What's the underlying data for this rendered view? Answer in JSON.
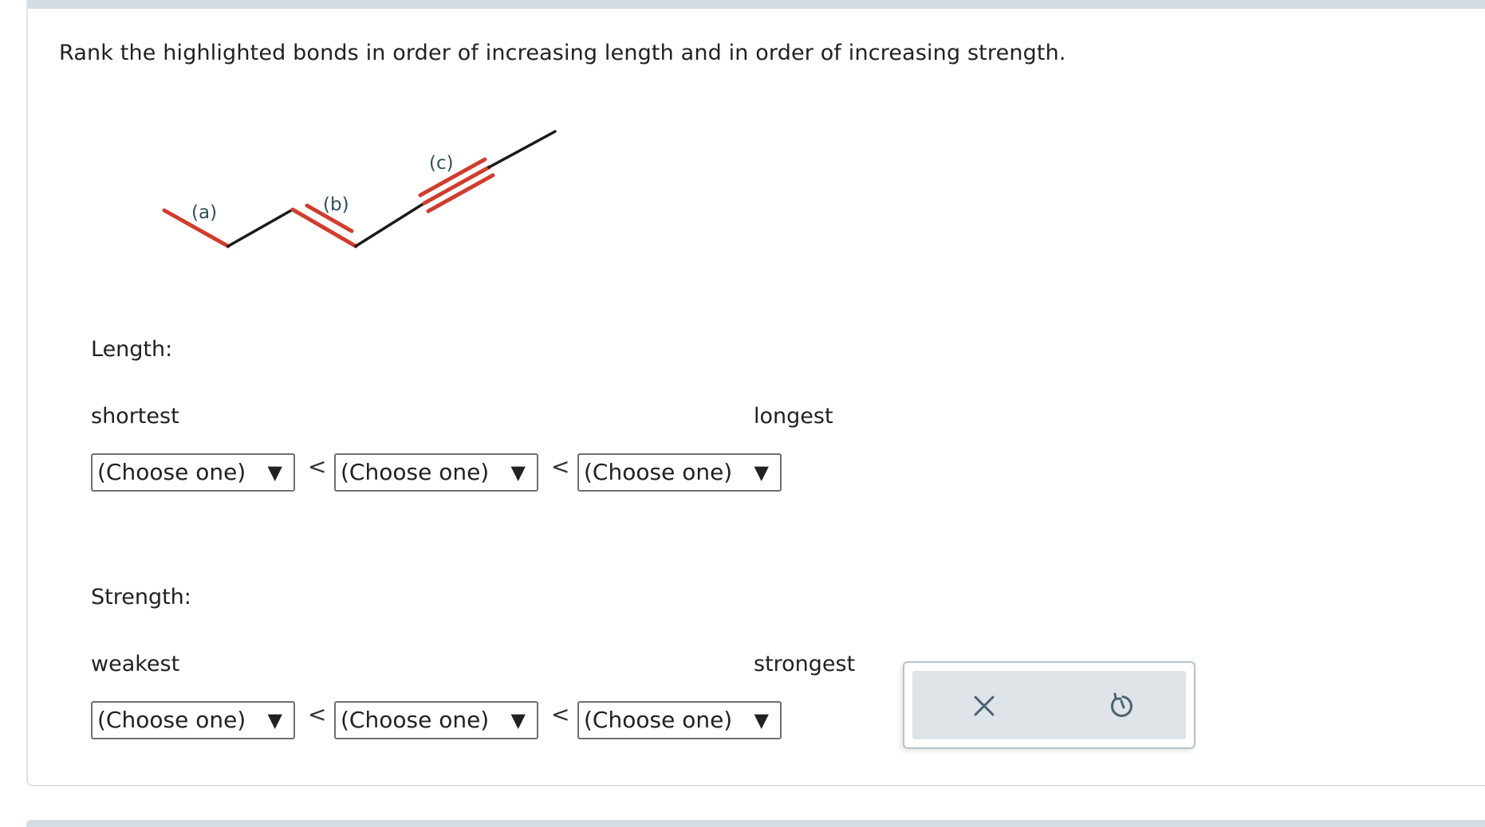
{
  "question": {
    "prompt": "Rank the highlighted bonds in order of increasing length and in order of increasing strength."
  },
  "molecule": {
    "bond_labels": [
      "(a)",
      "(b)",
      "(c)"
    ],
    "colors": {
      "highlight": "#d33b2c",
      "bond": "#1a1a1a",
      "label": "#2f4f5c"
    }
  },
  "length": {
    "label": "Length:",
    "low_label": "shortest",
    "high_label": "longest",
    "selects": [
      "(Choose one)",
      "(Choose one)",
      "(Choose one)"
    ],
    "separator": "<"
  },
  "strength": {
    "label": "Strength:",
    "low_label": "weakest",
    "high_label": "strongest",
    "selects": [
      "(Choose one)",
      "(Choose one)",
      "(Choose one)"
    ],
    "separator": "<"
  },
  "actions": {
    "clear_icon": "close-icon",
    "reset_icon": "undo-icon"
  }
}
